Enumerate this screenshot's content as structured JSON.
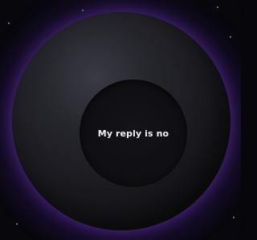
{
  "scene": {
    "answer_text": "My reply is no"
  },
  "colors": {
    "background": "#07070b",
    "glow": "#5c2aa0",
    "ball": "#1b1b21",
    "window": "#0f0f13",
    "text": "#f2f2f5"
  },
  "icons": {
    "ball": "magic-8-ball",
    "stars": "star-dots"
  }
}
